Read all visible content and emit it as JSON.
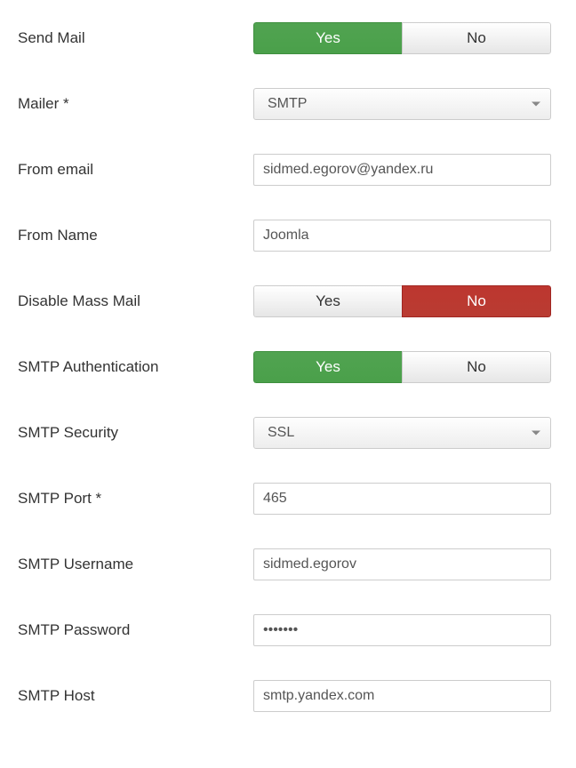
{
  "fields": {
    "send_mail": {
      "label": "Send Mail",
      "yes": "Yes",
      "no": "No",
      "selected": "yes"
    },
    "mailer": {
      "label": "Mailer *",
      "value": "SMTP"
    },
    "from_email": {
      "label": "From email",
      "value": "sidmed.egorov@yandex.ru"
    },
    "from_name": {
      "label": "From Name",
      "value": "Joomla"
    },
    "disable_mass_mail": {
      "label": "Disable Mass Mail",
      "yes": "Yes",
      "no": "No",
      "selected": "no"
    },
    "smtp_auth": {
      "label": "SMTP Authentication",
      "yes": "Yes",
      "no": "No",
      "selected": "yes"
    },
    "smtp_security": {
      "label": "SMTP Security",
      "value": "SSL"
    },
    "smtp_port": {
      "label": "SMTP Port *",
      "value": "465"
    },
    "smtp_username": {
      "label": "SMTP Username",
      "value": "sidmed.egorov"
    },
    "smtp_password": {
      "label": "SMTP Password",
      "value": "•••••••"
    },
    "smtp_host": {
      "label": "SMTP Host",
      "value": "smtp.yandex.com"
    }
  }
}
